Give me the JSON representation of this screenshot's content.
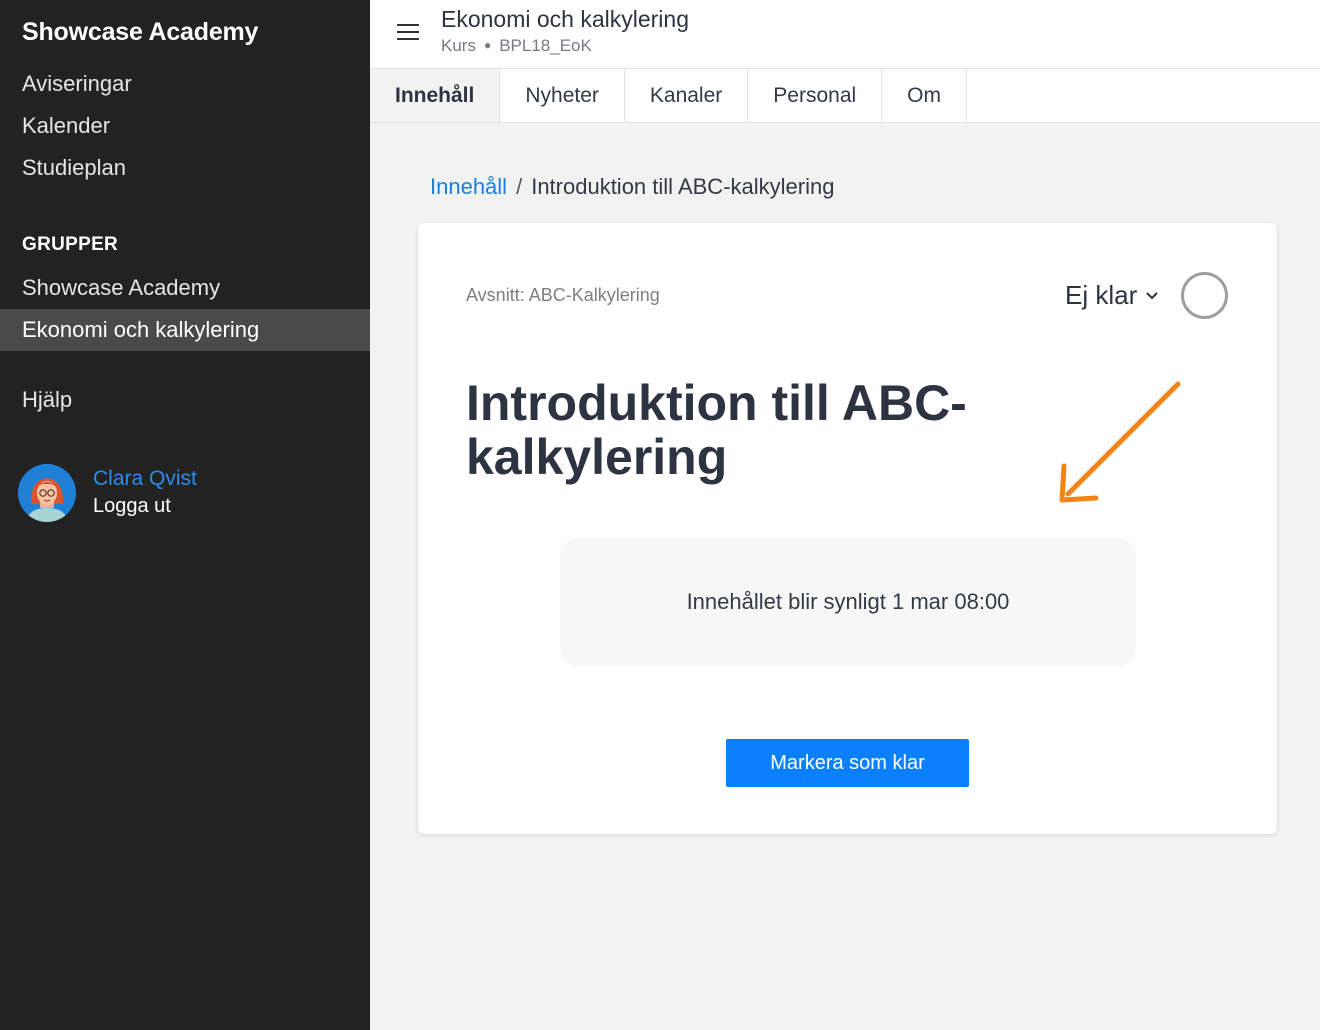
{
  "sidebar": {
    "brand": "Showcase Academy",
    "nav": [
      {
        "label": "Aviseringar"
      },
      {
        "label": "Kalender"
      },
      {
        "label": "Studieplan"
      }
    ],
    "groups_label": "GRUPPER",
    "groups": [
      {
        "label": "Showcase Academy",
        "active": false
      },
      {
        "label": "Ekonomi och kalkylering",
        "active": true
      }
    ],
    "help": "Hjälp",
    "user": {
      "name": "Clara Qvist",
      "logout": "Logga ut"
    }
  },
  "header": {
    "menu_icon": "hamburger-icon",
    "title": "Ekonomi och kalkylering",
    "type": "Kurs",
    "code": "BPL18_EoK"
  },
  "tabs": [
    {
      "label": "Innehåll",
      "active": true
    },
    {
      "label": "Nyheter",
      "active": false
    },
    {
      "label": "Kanaler",
      "active": false
    },
    {
      "label": "Personal",
      "active": false
    },
    {
      "label": "Om",
      "active": false
    }
  ],
  "breadcrumb": {
    "parent": "Innehåll",
    "separator": "/",
    "current": "Introduktion till ABC-kalkylering"
  },
  "card": {
    "section": "Avsnitt: ABC-Kalkylering",
    "status": "Ej klar",
    "title_line1": "Introduktion till ABC-",
    "title_line2": "kalkylering",
    "notice": "Innehållet blir synligt 1 mar 08:00",
    "mark_button": "Markera som klar"
  },
  "colors": {
    "sidebar_bg": "#222222",
    "accent": "#0a80ff",
    "link": "#1a7fe0",
    "annotation_arrow": "#f0861a"
  }
}
